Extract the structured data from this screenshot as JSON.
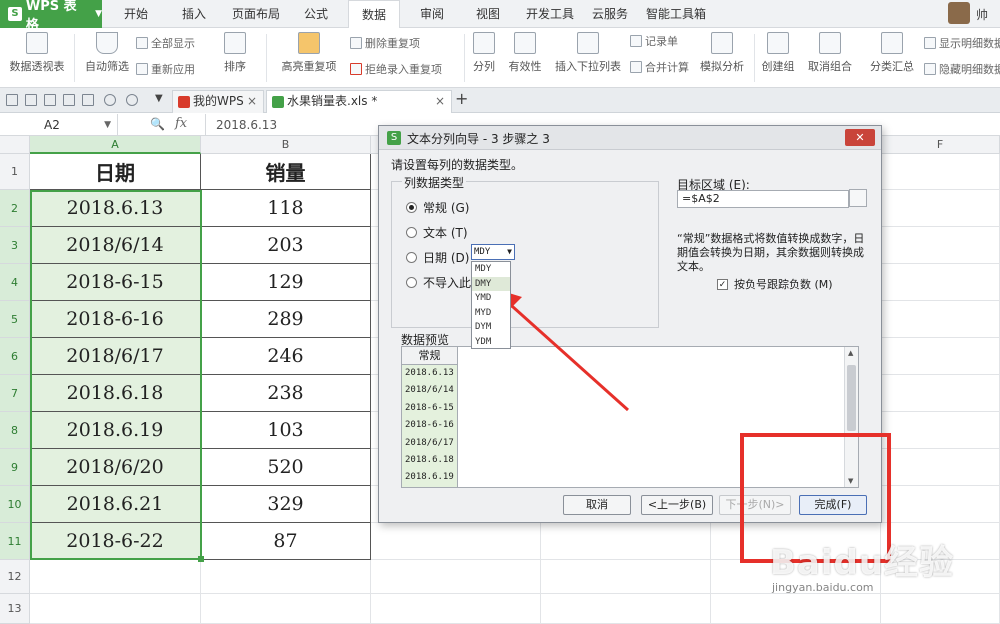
{
  "app": {
    "name": "WPS 表格",
    "logo_letter": "S"
  },
  "menu": {
    "tabs": [
      "开始",
      "插入",
      "页面布局",
      "公式",
      "数据",
      "审阅",
      "视图",
      "开发工具",
      "云服务",
      "智能工具箱"
    ],
    "active": "数据"
  },
  "user": {
    "name": "帅"
  },
  "ribbon": {
    "pivot": "数据透视表",
    "auto_filter": "自动筛选",
    "show_all": "全部显示",
    "reapply": "重新应用",
    "sort": "排序",
    "highlight_dup": "高亮重复项",
    "remove_dup": "删除重复项",
    "reject_dup": "拒绝录入重复项",
    "split": "分列",
    "validity": "有效性",
    "insert_dropdown": "插入下拉列表",
    "record": "记录单",
    "merge_calc": "合并计算",
    "sim_analysis": "模拟分析",
    "create_group": "创建组",
    "ungroup": "取消组合",
    "subtotal": "分类汇总",
    "show_detail": "显示明细数据",
    "hide_detail": "隐藏明细数据"
  },
  "doc_tabs": [
    {
      "label": "我的WPS",
      "icon_color": "#d83b2b"
    },
    {
      "label": "水果销量表.xls *",
      "icon_color": "#44a148"
    }
  ],
  "formula_bar": {
    "cell_ref": "A2",
    "fx": "fx",
    "content": "2018.6.13"
  },
  "sheet": {
    "columns": [
      "A",
      "B",
      "C",
      "D",
      "E",
      "F"
    ],
    "rows": [
      "1",
      "2",
      "3",
      "4",
      "5",
      "6",
      "7",
      "8",
      "9",
      "10",
      "11",
      "12",
      "13"
    ],
    "headers": [
      "日期",
      "销量"
    ],
    "dates": [
      "2018.6.13",
      "2018/6/14",
      "2018-6-15",
      "2018-6-16",
      "2018/6/17",
      "2018.6.18",
      "2018.6.19",
      "2018/6/20",
      "2018.6.21",
      "2018-6-22"
    ],
    "sales": [
      "118",
      "203",
      "129",
      "289",
      "246",
      "238",
      "103",
      "520",
      "329",
      "87"
    ]
  },
  "dialog": {
    "title": "文本分列向导 - 3 步骤之 3",
    "prompt": "请设置每列的数据类型。",
    "group_title": "列数据类型",
    "radio_general": "常规 (G)",
    "radio_text": "文本 (T)",
    "radio_date": "日期 (D)",
    "radio_skip": "不导入此列 (I)",
    "date_format": "MDY",
    "date_options": [
      "MDY",
      "DMY",
      "YMD",
      "MYD",
      "DYM",
      "YDM"
    ],
    "target_label": "目标区域 (E):",
    "target_value": "=$A$2",
    "description": "“常规”数据格式将数值转换成数字，日期值会转换为日期，其余数据则转换成文本。",
    "checkbox_label": "按负号跟踪负数 (M)",
    "preview_label": "数据预览",
    "preview_header": "常规",
    "preview_rows": [
      "2018.6.13",
      "2018/6/14",
      "2018-6-15",
      "2018-6-16",
      "2018/6/17",
      "2018.6.18",
      "2018.6.19"
    ],
    "buttons": {
      "cancel": "取消",
      "prev": "<上一步(B)",
      "next": "下一步(N)>",
      "finish": "完成(F)"
    }
  },
  "watermark": {
    "brand": "Baidu经验",
    "url": "jingyan.baidu.com"
  },
  "colors": {
    "accent_green": "#44a148",
    "annotation_red": "#e6302a",
    "selection_fill": "#e3f1df"
  }
}
